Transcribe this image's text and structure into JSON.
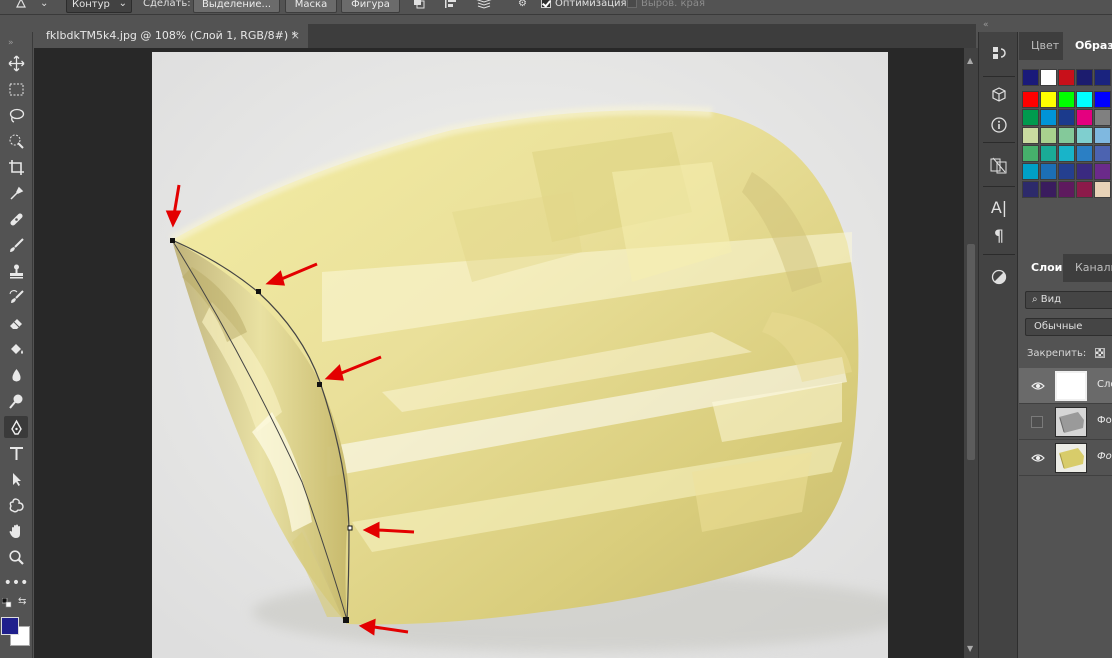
{
  "options_bar": {
    "mode_value": "Контур",
    "make_label": "Сделать:",
    "selection_button": "Выделение...",
    "mask_button": "Маска",
    "shape_button": "Фигура",
    "optimize_label": "Оптимизация",
    "optimize_checked": true,
    "align_edges_label": "Выров. края",
    "align_edges_checked": false
  },
  "document": {
    "tab_title": "fkIbdkTM5k4.jpg @ 108% (Слой 1, RGB/8#) *",
    "tab_close": "×"
  },
  "toolbar": {
    "tools": [
      "move-icon",
      "marquee-icon",
      "lasso-icon",
      "quick-select-icon",
      "crop-icon",
      "eyedropper-icon",
      "healing-icon",
      "brush-icon",
      "stamp-icon",
      "history-brush-icon",
      "eraser-icon",
      "paint-bucket-icon",
      "blur-icon",
      "dodge-icon",
      "pen-icon",
      "type-icon",
      "path-select-icon",
      "custom-shape-icon",
      "hand-icon",
      "zoom-icon",
      "more-icon"
    ],
    "active_tool": "pen-icon",
    "foreground_color": "#1f1f8c",
    "background_color": "#ffffff"
  },
  "panels": {
    "color_tab": "Цвет",
    "swatches_tab": "Образцы",
    "recent_swatches": [
      "#1a1a7a",
      "#ffffff",
      "#c8101a",
      "#1c1c6e",
      "#1a237e",
      "#0d1a4f"
    ],
    "swatches": [
      "#ff0000",
      "#ffff00",
      "#00ff00",
      "#00ffff",
      "#0000ff",
      "#009a4e",
      "#0094d8",
      "#1b3a8c",
      "#e4007f",
      "#808080",
      "#c9dba0",
      "#a9d18e",
      "#84c99a",
      "#7fcfcf",
      "#7fb8e0",
      "#46b06b",
      "#1aab96",
      "#18b4c9",
      "#2b7fc4",
      "#4c63b0",
      "#00a0c6",
      "#1c6fb5",
      "#243f8f",
      "#3a2a80",
      "#6b2a8a",
      "#2d2a6b",
      "#3a1c5e",
      "#5e1a5e",
      "#8c1a4a",
      "#e8d3b8"
    ],
    "layers_tab": "Слои",
    "channels_tab": "Каналы",
    "search_value": "Вид",
    "blend_mode": "Обычные",
    "lock_label": "Закрепить:",
    "layers": [
      {
        "name": "Сло",
        "visible": true,
        "selected": true,
        "italic": false
      },
      {
        "name": "Фо",
        "visible": false,
        "selected": false,
        "italic": false
      },
      {
        "name": "Фо",
        "visible": true,
        "selected": false,
        "italic": true
      }
    ]
  }
}
